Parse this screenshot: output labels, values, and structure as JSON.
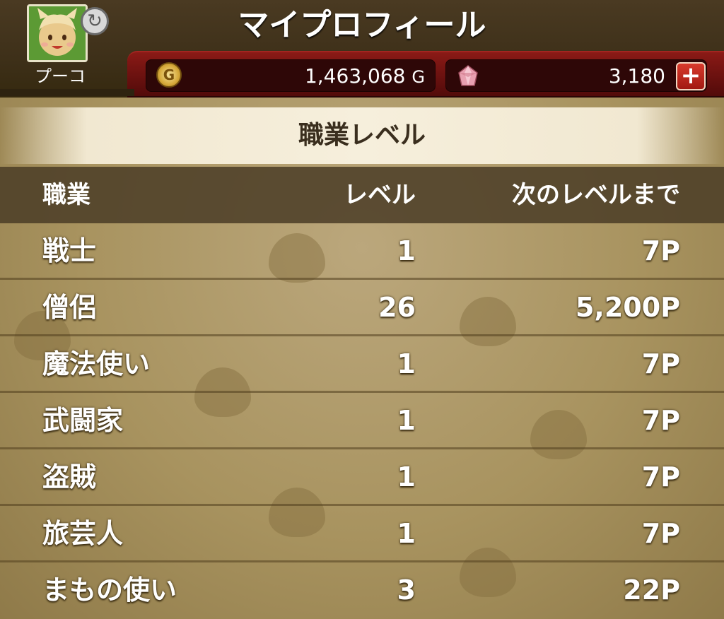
{
  "header": {
    "title": "マイプロフィール",
    "player_name": "プーコ",
    "gold_value": "1,463,068",
    "gold_unit": "G",
    "gold_icon_label": "G",
    "gem_value": "3,180",
    "plus_label": "+"
  },
  "section": {
    "title": "職業レベル"
  },
  "table": {
    "headers": {
      "job": "職業",
      "level": "レベル",
      "next": "次のレベルまで"
    },
    "rows": [
      {
        "job": "戦士",
        "level": "1",
        "next": "7P"
      },
      {
        "job": "僧侶",
        "level": "26",
        "next": "5,200P"
      },
      {
        "job": "魔法使い",
        "level": "1",
        "next": "7P"
      },
      {
        "job": "武闘家",
        "level": "1",
        "next": "7P"
      },
      {
        "job": "盗賊",
        "level": "1",
        "next": "7P"
      },
      {
        "job": "旅芸人",
        "level": "1",
        "next": "7P"
      },
      {
        "job": "まもの使い",
        "level": "3",
        "next": "22P"
      }
    ]
  },
  "colors": {
    "header_bg": "#3e3019",
    "red_bar": "#6e1210",
    "banner_bg": "#f6efdc",
    "parchment": "#a8935f"
  },
  "icons": [
    "avatar",
    "sync-icon",
    "gold-coin-icon",
    "gem-icon",
    "plus-icon"
  ]
}
